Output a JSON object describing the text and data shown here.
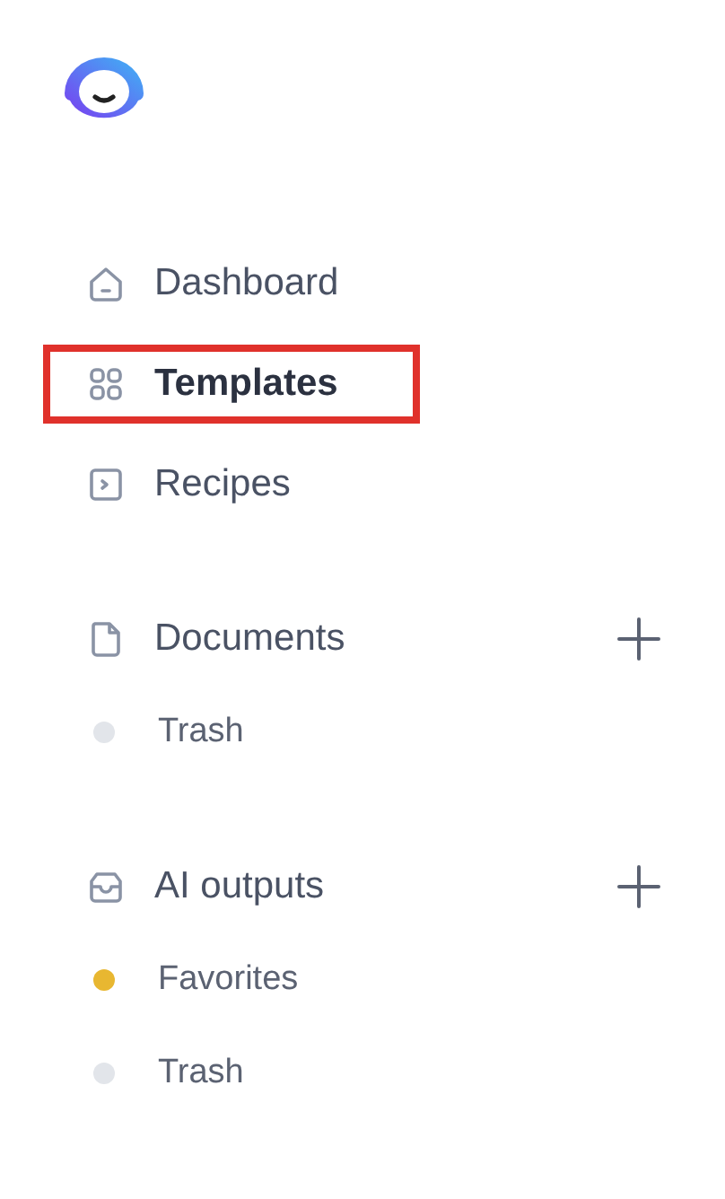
{
  "nav": [
    {
      "label": "Dashboard",
      "selected": false,
      "highlighted": false
    },
    {
      "label": "Templates",
      "selected": true,
      "highlighted": true
    },
    {
      "label": "Recipes",
      "selected": false,
      "highlighted": false
    }
  ],
  "sections": [
    {
      "label": "Documents",
      "items": [
        {
          "label": "Trash",
          "color": "#e2e5ea"
        }
      ]
    },
    {
      "label": "AI outputs",
      "items": [
        {
          "label": "Favorites",
          "color": "#e8b731"
        },
        {
          "label": "Trash",
          "color": "#e2e5ea"
        }
      ]
    }
  ]
}
